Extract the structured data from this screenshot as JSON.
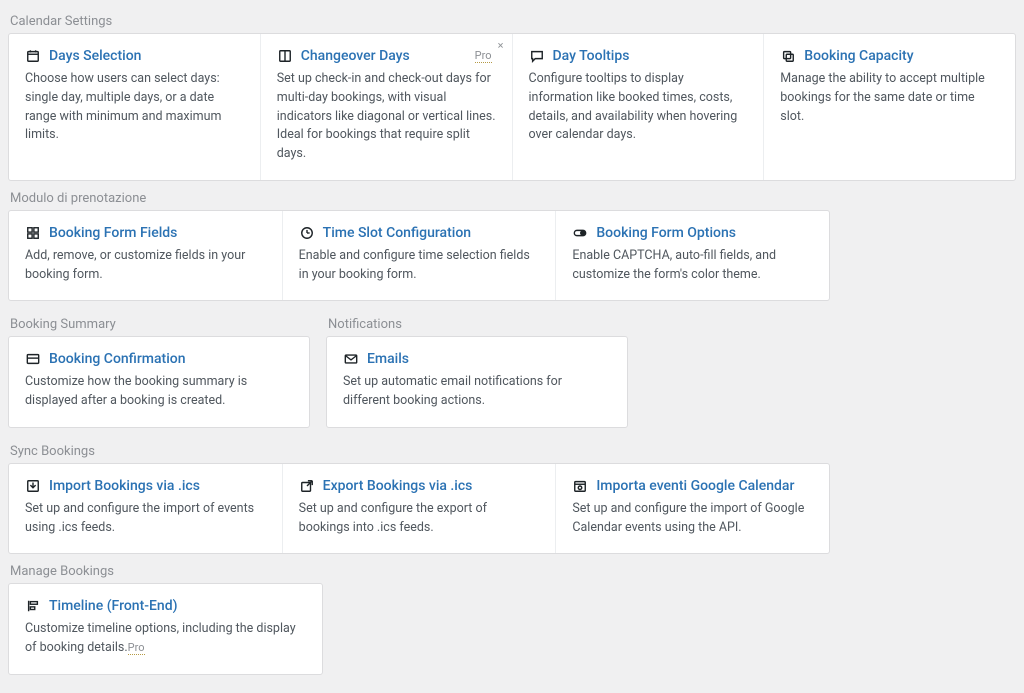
{
  "sections": {
    "calendar_settings": {
      "title": "Calendar Settings",
      "items": [
        {
          "title": "Days Selection",
          "desc": "Choose how users can select days: single day, multiple days, or a date range with minimum and maximum limits."
        },
        {
          "title": "Changeover Days",
          "badge": "Pro",
          "close": "×",
          "desc": "Set up check-in and check-out days for multi-day bookings, with visual indicators like diagonal or vertical lines. Ideal for bookings that require split days."
        },
        {
          "title": "Day Tooltips",
          "desc": "Configure tooltips to display information like booked times, costs, details, and availability when hovering over calendar days."
        },
        {
          "title": "Booking Capacity",
          "desc": "Manage the ability to accept multiple bookings for the same date or time slot."
        }
      ]
    },
    "booking_form": {
      "title": "Modulo di prenotazione",
      "items": [
        {
          "title": "Booking Form Fields",
          "desc": "Add, remove, or customize fields in your booking form."
        },
        {
          "title": "Time Slot Configuration",
          "desc": "Enable and configure time selection fields in your booking form."
        },
        {
          "title": "Booking Form Options",
          "desc": "Enable CAPTCHA, auto-fill fields, and customize the form's color theme."
        }
      ]
    },
    "booking_summary": {
      "title": "Booking Summary",
      "items": [
        {
          "title": "Booking Confirmation",
          "desc": "Customize how the booking summary is displayed after a booking is created."
        }
      ]
    },
    "notifications": {
      "title": "Notifications",
      "items": [
        {
          "title": "Emails",
          "desc": "Set up automatic email notifications for different booking actions."
        }
      ]
    },
    "sync_bookings": {
      "title": "Sync Bookings",
      "items": [
        {
          "title": "Import Bookings via .ics",
          "desc": "Set up and configure the import of events using .ics feeds."
        },
        {
          "title": "Export Bookings via .ics",
          "desc": "Set up and configure the export of bookings into .ics feeds."
        },
        {
          "title": "Importa eventi Google Calendar",
          "desc": "Set up and configure the import of Google Calendar events using the API."
        }
      ]
    },
    "manage_bookings": {
      "title": "Manage Bookings",
      "items": [
        {
          "title": "Timeline (Front-End)",
          "desc": "Customize timeline options, including the display of booking details.",
          "inline_badge": "Pro"
        }
      ]
    }
  }
}
